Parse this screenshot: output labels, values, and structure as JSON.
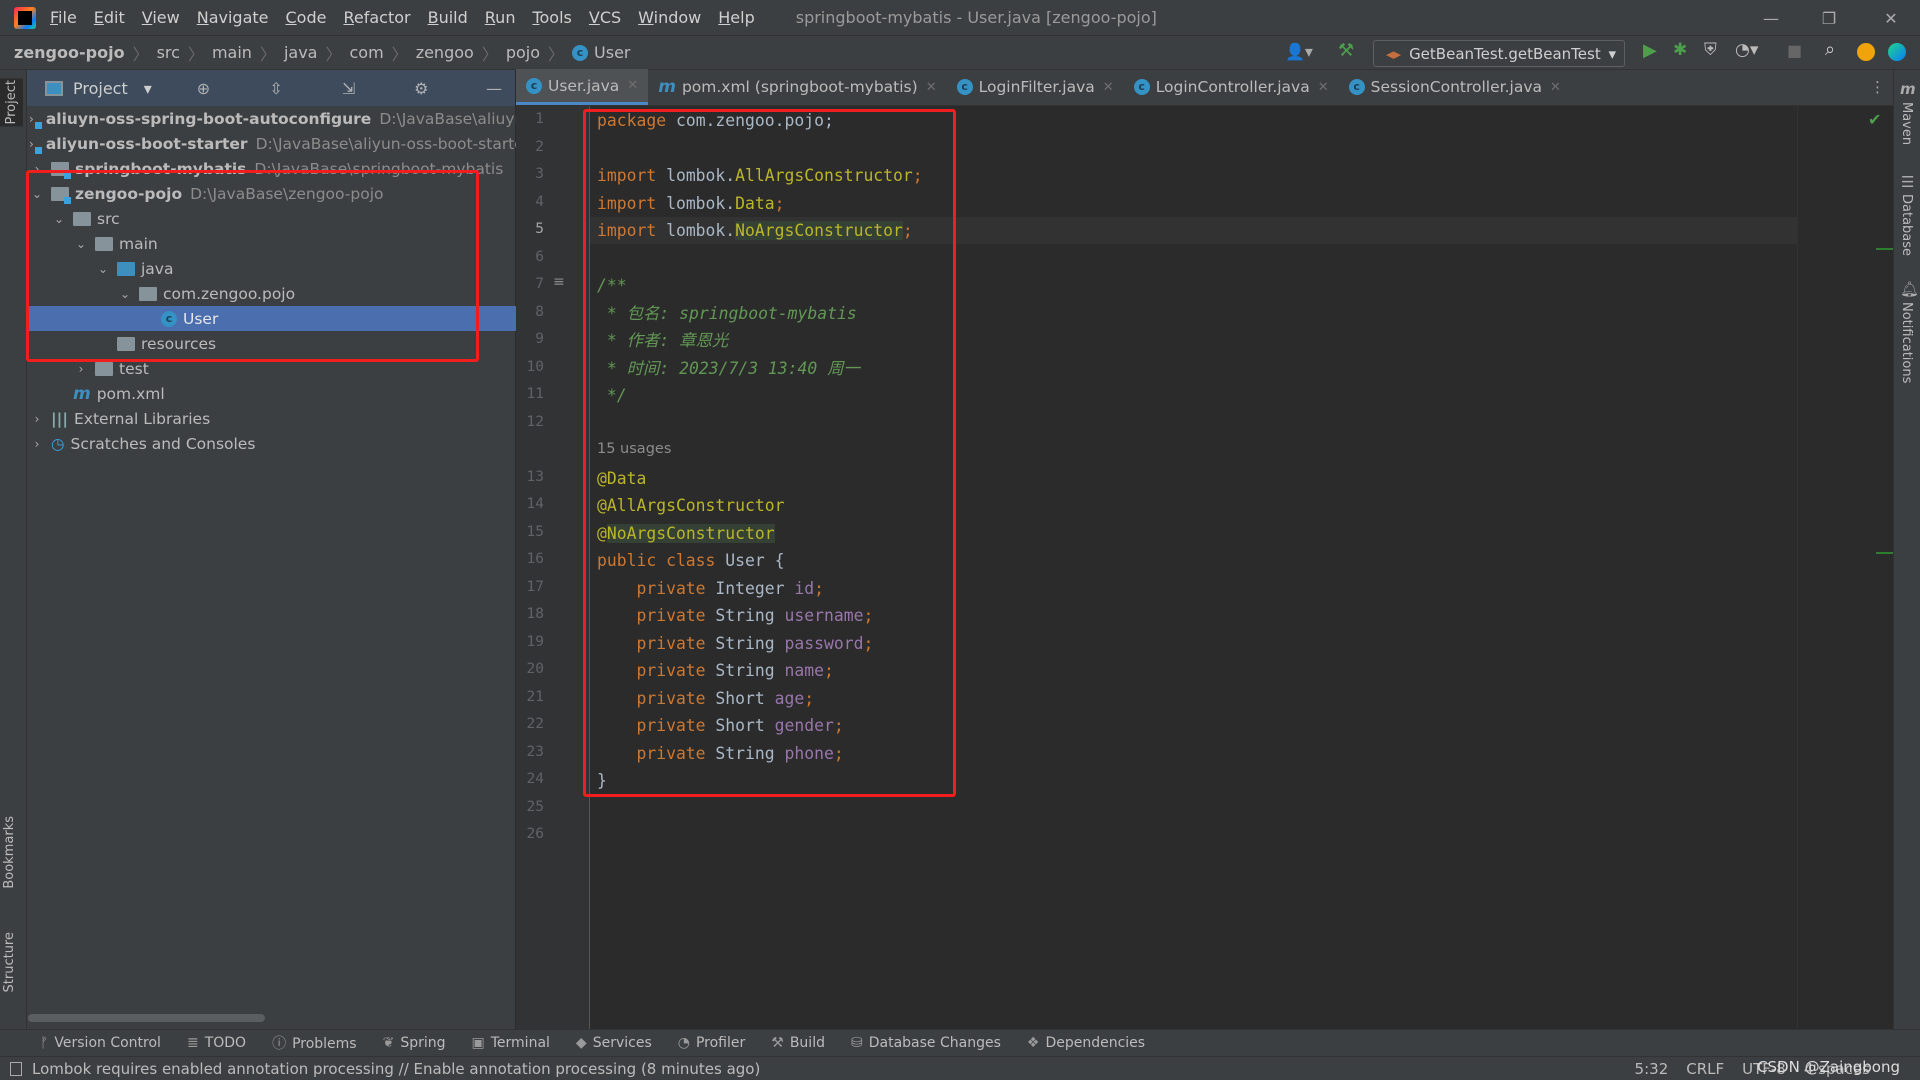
{
  "titlebar": {
    "menu": [
      "File",
      "Edit",
      "View",
      "Navigate",
      "Code",
      "Refactor",
      "Build",
      "Run",
      "Tools",
      "VCS",
      "Window",
      "Help"
    ],
    "title": "springboot-mybatis - User.java [zengoo-pojo]"
  },
  "breadcrumb": [
    "zengoo-pojo",
    "src",
    "main",
    "java",
    "com",
    "zengoo",
    "pojo",
    "User"
  ],
  "toolbar": {
    "run_config": "GetBeanTest.getBeanTest"
  },
  "project": {
    "header": "Project",
    "rows": [
      {
        "indent": 0,
        "arrow": "›",
        "icon": "module",
        "label": "aliuyn-oss-spring-boot-autoconfigure",
        "bold": true,
        "path": "D:\\JavaBase\\aliuyn-"
      },
      {
        "indent": 0,
        "arrow": "›",
        "icon": "module",
        "label": "aliyun-oss-boot-starter",
        "bold": true,
        "path": "D:\\JavaBase\\aliyun-oss-boot-starte"
      },
      {
        "indent": 0,
        "arrow": "›",
        "icon": "module",
        "label": "springboot-mybatis",
        "bold": true,
        "path": "D:\\JavaBase\\springboot-mybatis"
      },
      {
        "indent": 0,
        "arrow": "⌄",
        "icon": "module",
        "label": "zengoo-pojo",
        "bold": true,
        "path": "D:\\JavaBase\\zengoo-pojo"
      },
      {
        "indent": 1,
        "arrow": "⌄",
        "icon": "folder",
        "label": "src"
      },
      {
        "indent": 2,
        "arrow": "⌄",
        "icon": "folder",
        "label": "main"
      },
      {
        "indent": 3,
        "arrow": "⌄",
        "icon": "folder-blue",
        "label": "java"
      },
      {
        "indent": 4,
        "arrow": "⌄",
        "icon": "package",
        "label": "com.zengoo.pojo"
      },
      {
        "indent": 5,
        "arrow": "",
        "icon": "class",
        "label": "User",
        "selected": true
      },
      {
        "indent": 3,
        "arrow": "",
        "icon": "resources",
        "label": "resources"
      },
      {
        "indent": 2,
        "arrow": "›",
        "icon": "folder",
        "label": "test"
      },
      {
        "indent": 1,
        "arrow": "",
        "icon": "maven",
        "label": "pom.xml"
      },
      {
        "indent": 0,
        "arrow": "›",
        "icon": "libraries",
        "label": "External Libraries"
      },
      {
        "indent": 0,
        "arrow": "›",
        "icon": "scratches",
        "label": "Scratches and Consoles"
      }
    ]
  },
  "tabs": [
    {
      "label": "User.java",
      "icon": "class",
      "active": true
    },
    {
      "label": "pom.xml (springboot-mybatis)",
      "icon": "maven"
    },
    {
      "label": "LoginFilter.java",
      "icon": "class"
    },
    {
      "label": "LoginController.java",
      "icon": "class"
    },
    {
      "label": "SessionController.java",
      "icon": "class"
    }
  ],
  "editor": {
    "current_line": 5,
    "usages": "15 usages",
    "lines": [
      [
        [
          "kw",
          "package "
        ],
        [
          "pl",
          "com.zengoo.pojo;"
        ]
      ],
      [],
      [
        [
          "kw",
          "import "
        ],
        [
          "pl",
          "lombok."
        ],
        [
          "an",
          "AllArgsConstructor"
        ],
        [
          "kw",
          ";"
        ]
      ],
      [
        [
          "kw",
          "import "
        ],
        [
          "pl",
          "lombok."
        ],
        [
          "an",
          "Data"
        ],
        [
          "kw",
          ";"
        ]
      ],
      [
        [
          "kw",
          "import "
        ],
        [
          "pl",
          "lombok."
        ],
        [
          "an ann-hl",
          "NoArgsConstructor"
        ],
        [
          "kw",
          ";"
        ]
      ],
      [],
      [
        [
          "dc",
          "/**"
        ]
      ],
      [
        [
          "dc",
          " * 包名: springboot-mybatis"
        ]
      ],
      [
        [
          "dc",
          " * 作者: 章恩光"
        ]
      ],
      [
        [
          "dc",
          " * 时间: 2023/7/3 13:40 周一"
        ]
      ],
      [
        [
          "dc",
          " */"
        ]
      ],
      [],
      [
        [
          "an",
          "@Data"
        ]
      ],
      [
        [
          "an",
          "@AllArgsConstructor"
        ]
      ],
      [
        [
          "an",
          "@"
        ],
        [
          "an ann-hl",
          "NoArgsConstructor"
        ]
      ],
      [
        [
          "kw",
          "public class "
        ],
        [
          "pl",
          "User {"
        ]
      ],
      [
        [
          "kw",
          "    private "
        ],
        [
          "pl",
          "Integer "
        ],
        [
          "fd",
          "id"
        ],
        [
          "kw",
          ";"
        ]
      ],
      [
        [
          "kw",
          "    private "
        ],
        [
          "pl",
          "String "
        ],
        [
          "fd",
          "username"
        ],
        [
          "kw",
          ";"
        ]
      ],
      [
        [
          "kw",
          "    private "
        ],
        [
          "pl",
          "String "
        ],
        [
          "fd",
          "password"
        ],
        [
          "kw",
          ";"
        ]
      ],
      [
        [
          "kw",
          "    private "
        ],
        [
          "pl",
          "String "
        ],
        [
          "fd",
          "name"
        ],
        [
          "kw",
          ";"
        ]
      ],
      [
        [
          "kw",
          "    private "
        ],
        [
          "pl",
          "Short "
        ],
        [
          "fd",
          "age"
        ],
        [
          "kw",
          ";"
        ]
      ],
      [
        [
          "kw",
          "    private "
        ],
        [
          "pl",
          "Short "
        ],
        [
          "fd",
          "gender"
        ],
        [
          "kw",
          ";"
        ]
      ],
      [
        [
          "kw",
          "    private "
        ],
        [
          "pl",
          "String "
        ],
        [
          "fd",
          "phone"
        ],
        [
          "kw",
          ";"
        ]
      ],
      [
        [
          "pl",
          "}"
        ]
      ],
      [],
      []
    ]
  },
  "left_strip": {
    "project": "Project",
    "bookmarks": "Bookmarks",
    "structure": "Structure"
  },
  "right_strip": {
    "maven": "Maven",
    "database": "Database",
    "notifications": "Notifications"
  },
  "bottom_tools": [
    "Version Control",
    "TODO",
    "Problems",
    "Spring",
    "Terminal",
    "Services",
    "Profiler",
    "Build",
    "Database Changes",
    "Dependencies"
  ],
  "status": {
    "message": "Lombok requires enabled annotation processing // Enable annotation processing (8 minutes ago)",
    "position": "5:32",
    "line_sep": "CRLF",
    "encoding": "UTF-8",
    "indent": "4 spaces",
    "watermark": "CSDN @Zaingbong"
  },
  "colors": {
    "keyword": "#cc7832",
    "annotation": "#bbb529",
    "field": "#9876aa",
    "doc_comment": "#629755",
    "highlight_box": "#f01e1e",
    "selection": "#4b6eaf"
  }
}
